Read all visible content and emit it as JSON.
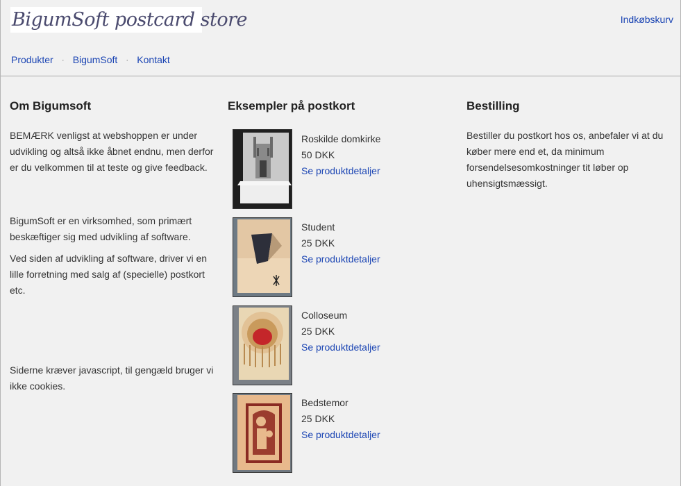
{
  "header": {
    "logo_text": "BigumSoft postcard store",
    "cart_link": "Indkøbskurv"
  },
  "nav": {
    "items": [
      "Produkter",
      "BigumSoft",
      "Kontakt"
    ],
    "separator": "·"
  },
  "about": {
    "title": "Om Bigumsoft",
    "p1": "BEMÆRK venligst at webshoppen er under udvikling og altså ikke åbnet endnu, men derfor er du velkommen til at teste og give feedback.",
    "p2": "BigumSoft er en virksomhed, som primært beskæftiger sig med udvikling af software.",
    "p3": "Ved siden af udvikling af software, driver vi en lille forretning med salg af (specielle) postkort etc.",
    "p4": "Siderne kræver javascript, til gengæld bruger vi ikke cookies."
  },
  "examples": {
    "title": "Eksempler på postkort",
    "link_label": "Se produktdetaljer",
    "products": [
      {
        "name": "Roskilde domkirke",
        "price": "50 DKK"
      },
      {
        "name": "Student",
        "price": "25 DKK"
      },
      {
        "name": "Colloseum",
        "price": "25 DKK"
      },
      {
        "name": "Bedstemor",
        "price": "25 DKK"
      }
    ]
  },
  "ordering": {
    "title": "Bestilling",
    "text": "Bestiller du postkort hos os, anbefaler vi at du køber mere end et, da minimum forsendelsesomkostninger tit løber op uhensigtsmæssigt."
  }
}
